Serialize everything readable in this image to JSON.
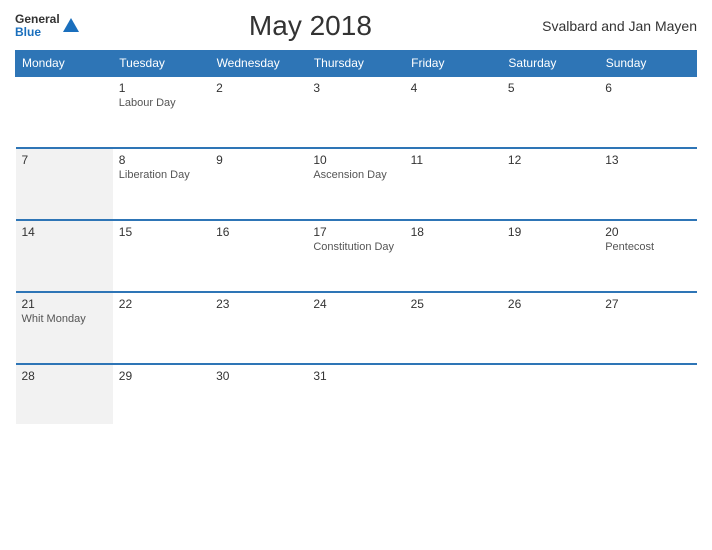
{
  "header": {
    "logo_general": "General",
    "logo_blue": "Blue",
    "title": "May 2018",
    "region": "Svalbard and Jan Mayen"
  },
  "days_header": [
    "Monday",
    "Tuesday",
    "Wednesday",
    "Thursday",
    "Friday",
    "Saturday",
    "Sunday"
  ],
  "weeks": [
    [
      {
        "num": "",
        "holiday": ""
      },
      {
        "num": "1",
        "holiday": "Labour Day"
      },
      {
        "num": "2",
        "holiday": ""
      },
      {
        "num": "3",
        "holiday": ""
      },
      {
        "num": "4",
        "holiday": ""
      },
      {
        "num": "5",
        "holiday": ""
      },
      {
        "num": "6",
        "holiday": ""
      }
    ],
    [
      {
        "num": "7",
        "holiday": ""
      },
      {
        "num": "8",
        "holiday": "Liberation Day"
      },
      {
        "num": "9",
        "holiday": ""
      },
      {
        "num": "10",
        "holiday": "Ascension Day"
      },
      {
        "num": "11",
        "holiday": ""
      },
      {
        "num": "12",
        "holiday": ""
      },
      {
        "num": "13",
        "holiday": ""
      }
    ],
    [
      {
        "num": "14",
        "holiday": ""
      },
      {
        "num": "15",
        "holiday": ""
      },
      {
        "num": "16",
        "holiday": ""
      },
      {
        "num": "17",
        "holiday": "Constitution Day"
      },
      {
        "num": "18",
        "holiday": ""
      },
      {
        "num": "19",
        "holiday": ""
      },
      {
        "num": "20",
        "holiday": "Pentecost"
      }
    ],
    [
      {
        "num": "21",
        "holiday": "Whit Monday"
      },
      {
        "num": "22",
        "holiday": ""
      },
      {
        "num": "23",
        "holiday": ""
      },
      {
        "num": "24",
        "holiday": ""
      },
      {
        "num": "25",
        "holiday": ""
      },
      {
        "num": "26",
        "holiday": ""
      },
      {
        "num": "27",
        "holiday": ""
      }
    ],
    [
      {
        "num": "28",
        "holiday": ""
      },
      {
        "num": "29",
        "holiday": ""
      },
      {
        "num": "30",
        "holiday": ""
      },
      {
        "num": "31",
        "holiday": ""
      },
      {
        "num": "",
        "holiday": ""
      },
      {
        "num": "",
        "holiday": ""
      },
      {
        "num": "",
        "holiday": ""
      }
    ]
  ]
}
